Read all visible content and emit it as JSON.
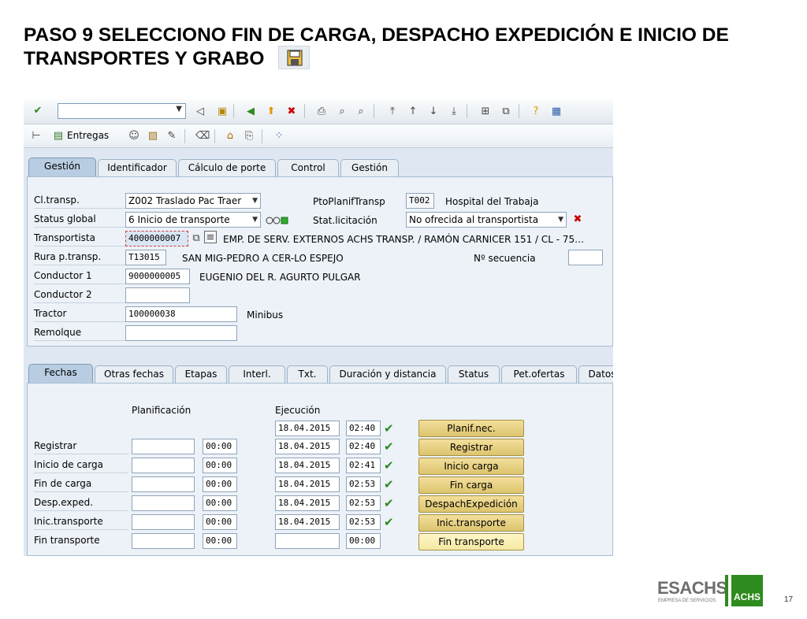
{
  "slide": {
    "title": "PASO 9 SELECCIONO FIN DE CARGA, DESPACHO EXPEDICIÓN E INICIO DE TRANSPORTES Y GRABO",
    "page_number": "17"
  },
  "toolbar": {
    "entregas_label": "Entregas"
  },
  "top_tabs": [
    "Gestión",
    "Identificador",
    "Cálculo de porte",
    "Control",
    "Gestión"
  ],
  "header": {
    "cl_transp_label": "Cl.transp.",
    "cl_transp_value": "Z002 Traslado Pac Traer",
    "ptoplanif_label": "PtoPlanifTransp",
    "ptoplanif_value": "T002",
    "ptoplanif_desc": "Hospital del Trabaja",
    "status_label": "Status global",
    "status_value": "6 Inicio de transporte",
    "stat_licit_label": "Stat.licitación",
    "stat_licit_value": "No ofrecida al transportista",
    "transportista_label": "Transportista",
    "transportista_value": "4000000007",
    "transportista_desc": "EMP. DE SERV. EXTERNOS ACHS TRANSP. / RAMÓN CARNICER 151 / CL - 75…",
    "ruta_label": "Rura p.transp.",
    "ruta_value": "T13015",
    "ruta_desc": "SAN MIG-PEDRO A CER-LO ESPEJO",
    "secuencia_label": "Nº secuencia",
    "secuencia_value": "",
    "conductor1_label": "Conductor 1",
    "conductor1_value": "9000000005",
    "conductor1_desc": "EUGENIO DEL R. AGURTO PULGAR",
    "conductor2_label": "Conductor 2",
    "conductor2_value": "",
    "tractor_label": "Tractor",
    "tractor_value": "100000038",
    "tractor_desc": "Minibus",
    "remolque_label": "Remolque",
    "remolque_value": ""
  },
  "sub_tabs": [
    "Fechas",
    "Otras fechas",
    "Etapas",
    "Interl.",
    "Txt.",
    "Duración y distancia",
    "Status",
    "Pet.ofertas",
    "Datos"
  ],
  "dates": {
    "planificacion_label": "Planificación",
    "ejecucion_label": "Ejecución",
    "planif_btn": "Planif.nec.",
    "planif_date": "18.04.2015",
    "planif_time": "02:40",
    "rows": [
      {
        "label": "Registrar",
        "plan_date": "",
        "plan_time": "00:00",
        "exec_date": "18.04.2015",
        "exec_time": "02:40",
        "button": "Registrar"
      },
      {
        "label": "Inicio de carga",
        "plan_date": "",
        "plan_time": "00:00",
        "exec_date": "18.04.2015",
        "exec_time": "02:41",
        "button": "Inicio carga"
      },
      {
        "label": "Fin de carga",
        "plan_date": "",
        "plan_time": "00:00",
        "exec_date": "18.04.2015",
        "exec_time": "02:53",
        "button": "Fin carga"
      },
      {
        "label": "Desp.exped.",
        "plan_date": "",
        "plan_time": "00:00",
        "exec_date": "18.04.2015",
        "exec_time": "02:53",
        "button": "DespachExpedición"
      },
      {
        "label": "Inic.transporte",
        "plan_date": "",
        "plan_time": "00:00",
        "exec_date": "18.04.2015",
        "exec_time": "02:53",
        "button": "Inic.transporte"
      },
      {
        "label": "Fin transporte",
        "plan_date": "",
        "plan_time": "00:00",
        "exec_date": "",
        "exec_time": "00:00",
        "button": "Fin transporte"
      }
    ]
  },
  "logo": {
    "brand": "ESACHS",
    "tagline": "EMPRESA DE SERVICIOS",
    "mark": "ACHS"
  },
  "colors": {
    "accent_green": "#2e8b1e",
    "button_gold": "#dcc46e",
    "panel_blue": "#edf2f8"
  }
}
